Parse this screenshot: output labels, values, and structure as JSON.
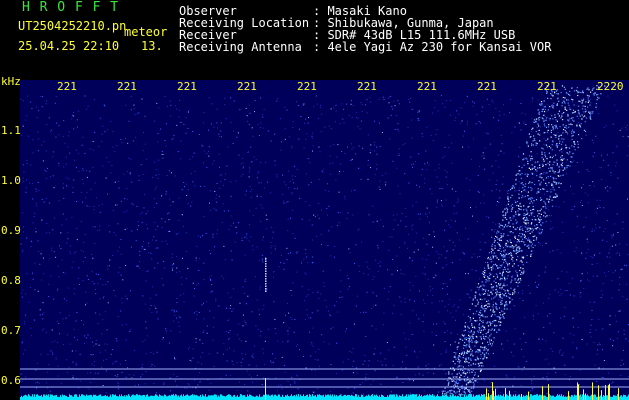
{
  "header": {
    "logo": "H R O F F T",
    "filename": "UT2504252210.pn",
    "tag": "meteor",
    "datetime": "25.04.25 22:10",
    "page": "13.",
    "info": [
      {
        "label": "Observer",
        "value": ": Masaki Kano"
      },
      {
        "label": "Receiving Location",
        "value": ": Shibukawa, Gunma, Japan"
      },
      {
        "label": "Receiver",
        "value": ": SDR# 43dB L15 111.6MHz USB"
      },
      {
        "label": "Receiving Antenna",
        "value": ": 4ele Yagi Az 230 for Kansai VOR"
      }
    ]
  },
  "chart_data": {
    "type": "heatmap",
    "ylabel": "kHz",
    "y_ticks": [
      "1.1",
      "1.0",
      "0.9",
      "0.8",
      "0.7",
      "0.6"
    ],
    "x_ticks": [
      "221",
      "221",
      "221",
      "221",
      "221",
      "221",
      "221",
      "221",
      "221",
      "2220"
    ],
    "colors": {
      "background": "#000070",
      "noise": "#3a5fff",
      "signal": "#b0e0ff",
      "baseline": "#00e5ff",
      "ticks": "#ffff33"
    }
  }
}
